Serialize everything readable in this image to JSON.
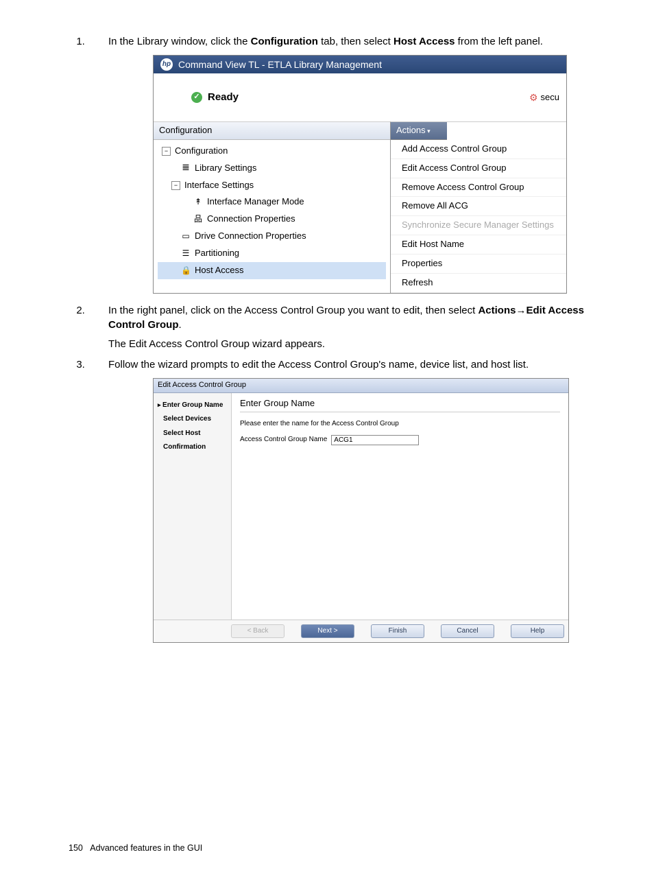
{
  "step1": {
    "prefix": "In the Library window, click the ",
    "bold1": "Configuration",
    "mid": " tab, then select ",
    "bold2": "Host Access",
    "suffix": " from the left panel."
  },
  "fig1": {
    "title": "Command View TL - ETLA Library Management",
    "status": "Ready",
    "secure": "secu",
    "left_header": "Configuration",
    "actions_header": "Actions",
    "tree": {
      "root": "Configuration",
      "library_settings": "Library Settings",
      "interface_settings": "Interface Settings",
      "interface_manager_mode": "Interface Manager Mode",
      "connection_properties": "Connection Properties",
      "drive_connection_properties": "Drive Connection Properties",
      "partitioning": "Partitioning",
      "host_access": "Host Access"
    },
    "actions": {
      "add_acg": "Add Access Control Group",
      "edit_acg": "Edit Access Control Group",
      "remove_acg": "Remove Access Control Group",
      "remove_all_acg": "Remove All ACG",
      "sync_secure": "Synchronize Secure Manager Settings",
      "edit_host": "Edit Host Name",
      "properties": "Properties",
      "refresh": "Refresh"
    }
  },
  "step2": {
    "prefix": "In the right panel, click on the Access Control Group you want to edit, then select ",
    "bold1": "Actions",
    "arrow": "→",
    "bold2": "Edit Access Control Group",
    "suffix": ".",
    "line2": "The Edit Access Control Group wizard appears."
  },
  "step3": {
    "text": "Follow the wizard prompts to edit the Access Control Group's name, device list, and host list."
  },
  "fig2": {
    "title": "Edit Access Control Group",
    "wizard_steps": {
      "enter_group_name": "Enter Group Name",
      "select_devices": "Select Devices",
      "select_host": "Select Host",
      "confirmation": "Confirmation"
    },
    "content_title": "Enter Group Name",
    "instruction": "Please enter the name for the Access Control Group",
    "field_label": "Access Control Group Name",
    "field_value": "ACG1",
    "buttons": {
      "back": "< Back",
      "next": "Next >",
      "finish": "Finish",
      "cancel": "Cancel",
      "help": "Help"
    }
  },
  "footer": {
    "page": "150",
    "text": "Advanced features in the GUI"
  }
}
